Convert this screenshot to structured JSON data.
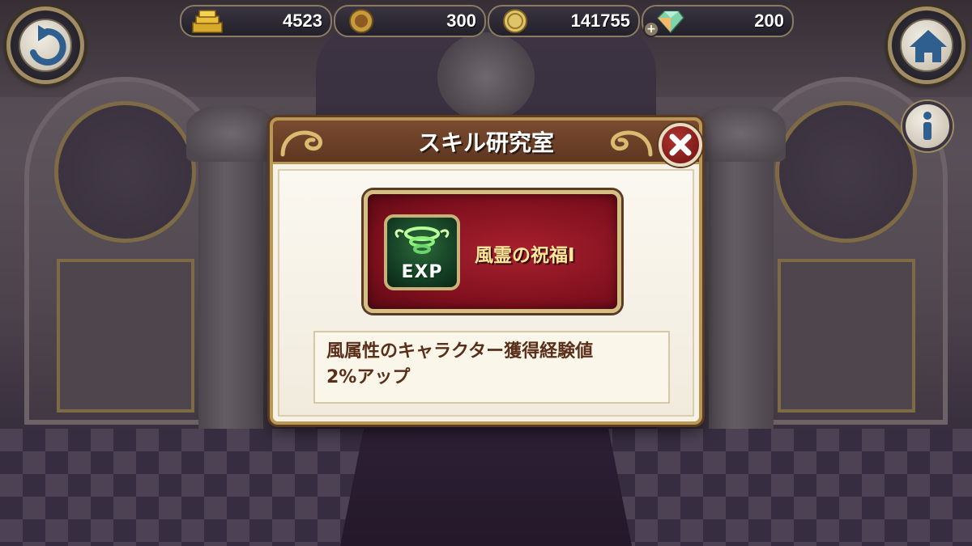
{
  "currencies": {
    "gold": {
      "value": "4523",
      "icon": "gold-bars-icon"
    },
    "medal": {
      "value": "300",
      "icon": "medal-icon"
    },
    "coin": {
      "value": "141755",
      "icon": "coin-icon"
    },
    "gem": {
      "value": "200",
      "icon": "gem-icon"
    }
  },
  "buttons": {
    "back": {
      "icon": "back-arrow-icon"
    },
    "home": {
      "icon": "home-icon"
    },
    "info": {
      "icon": "info-icon"
    },
    "close": {
      "icon": "close-icon"
    }
  },
  "dialog": {
    "title": "スキル研究室",
    "skill": {
      "name": "風霊の祝福I",
      "badge": "EXP"
    },
    "description": {
      "line1": "風属性のキャラクター獲得経験値",
      "line2": "2%アップ"
    }
  },
  "colors": {
    "accent_gold": "#b99755",
    "header_brown": "#6a3f27",
    "card_red": "#8a1622",
    "skill_name": "#ffe89a",
    "desc_text": "#5a2f1a"
  }
}
